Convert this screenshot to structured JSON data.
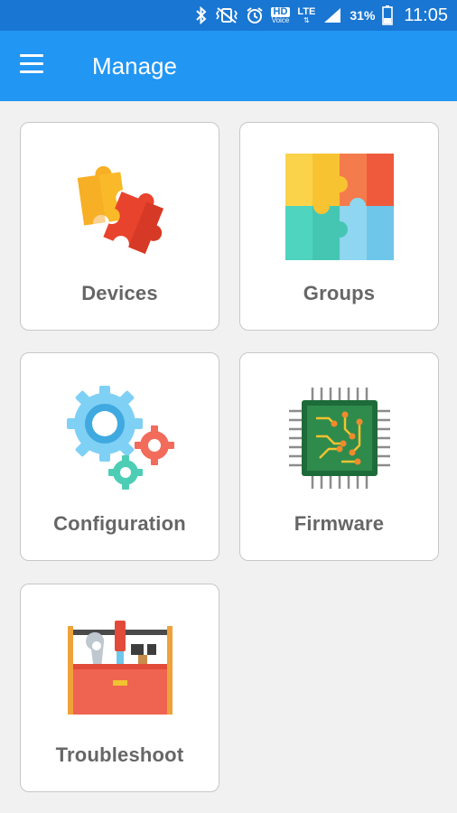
{
  "status_bar": {
    "hd_label": "HD",
    "voice_label": "Voice",
    "lte_label": "LTE",
    "battery_text": "31%",
    "time": "11:05",
    "icons": [
      "bluetooth-icon",
      "vibrate-icon",
      "alarm-icon",
      "hd-voice-icon",
      "lte-icon",
      "signal-icon",
      "battery-icon"
    ]
  },
  "app_bar": {
    "title": "Manage",
    "menu_icon": "hamburger-menu-icon",
    "color": "#2196f3",
    "status_color": "#1976d2"
  },
  "tiles": [
    {
      "label": "Devices",
      "icon": "puzzle-pieces-icon"
    },
    {
      "label": "Groups",
      "icon": "puzzle-grid-icon"
    },
    {
      "label": "Configuration",
      "icon": "gears-icon"
    },
    {
      "label": "Firmware",
      "icon": "chip-icon"
    },
    {
      "label": "Troubleshoot",
      "icon": "toolbox-icon"
    }
  ]
}
